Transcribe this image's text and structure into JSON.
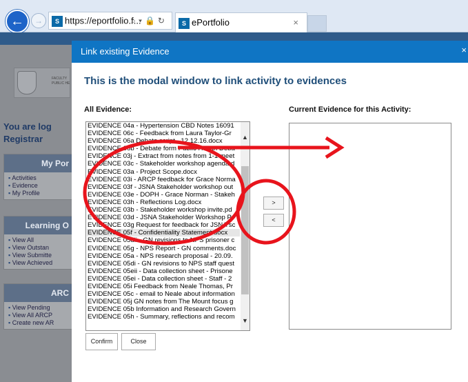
{
  "browser": {
    "url": "https://eportfolio.f...",
    "tab_title": "ePortfolio",
    "tab_icon": "S"
  },
  "sidebar": {
    "logo_text": "FACULTY\nPUBLIC HE",
    "user_line1": "You are log",
    "user_line2": "Registrar",
    "panels": [
      {
        "title": "My Por",
        "items": [
          "Activities",
          "Evidence",
          "My Profile"
        ]
      },
      {
        "title": "Learning O",
        "items": [
          "View All",
          "View Outstan",
          "View Submitte",
          "View Achieved"
        ]
      },
      {
        "title": "ARC",
        "items": [
          "View Pending",
          "View All ARCP",
          "Create new AR"
        ]
      }
    ]
  },
  "modal": {
    "title": "Link existing Evidence",
    "heading": "This is the modal window to link activity to evidences",
    "all_label": "All Evidence:",
    "current_label": "Current Evidence for this Activity:",
    "add_button": ">",
    "remove_button": "<",
    "confirm_button": "Confirm",
    "close_button": "Close",
    "evidence": [
      "EVIDENCE 04a - Hypertension CBD Notes 16091",
      "EVIDENCE 06c - Feedback from Laura Taylor-Gr",
      "EVIDENCE 06a Debate script - 12.12.16.docx",
      "EVIDENCE 06b - Debate form Public Health Deba",
      "EVIDENCE 03j - Extract from notes from 1-1 meet",
      "EVIDENCE 03c - Stakeholder workshop agenda.d",
      "EVIDENCE 03a - Project Scope.docx",
      "EVIDENCE 03i - ARCP feedback for Grace Norma",
      "EVIDENCE 03f - JSNA Stakeholder workshop out",
      "EVIDENCE 03e - DOPH - Grace Norman - Stakeh",
      "EVIDENCE 03h - Reflections Log.docx",
      "EVIDENCE 03b - Stakeholder workshop invite.pd",
      "EVIDENCE 03d - JSNA Stakeholder Workshop P",
      "EVIDENCE 03g Request for feedback for JSNA sc",
      "EVIDENCE 05f - Confidentiality Statement.docx",
      "EVIDENCE 05dii - GN revisions to NPS prisoner c",
      "EVIDENCE 05g - NPS Report - GN comments.doc",
      "EVIDENCE 05a - NPS research proposal - 20.09.",
      "EVIDENCE 05di - GN revisions to NPS staff quest",
      "EVIDENCE 05eii - Data collection sheet - Prisone",
      "EVIDENCE 05ei - Data collection sheet - Staff - 2",
      "EVIDENCE 05i Feedback from Neale Thomas, Pr",
      "EVIDENCE 05c - email to Neale about information",
      "EVIDENCE 05j GN notes from The Mount focus g",
      "EVIDENCE 05b Information and Research Govern",
      "EVIDENCE 05h - Summary, reflections and recom"
    ],
    "selected_index": 14,
    "current_evidence": []
  },
  "annotation_color": "#e8141c"
}
